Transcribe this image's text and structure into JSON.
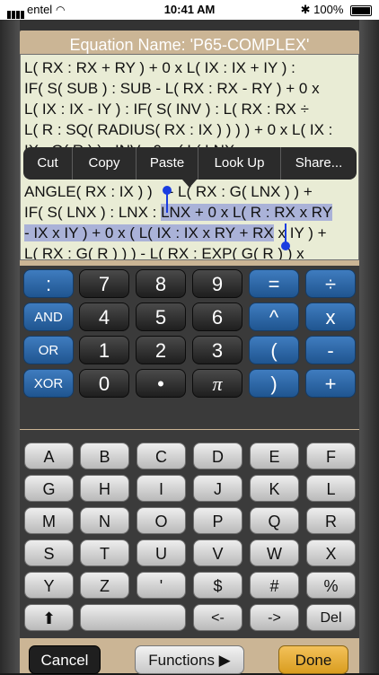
{
  "status": {
    "carrier": "entel",
    "time": "10:41 AM",
    "battery": "100%"
  },
  "title": "Equation Name: 'P65-COMPLEX'",
  "editor": {
    "line1": "L( RX : RX + RY ) + 0 x L( IX : IX + IY ) :",
    "line2": "IF( S( SUB ) : SUB - L( RX : RX - RY ) + 0 x",
    "line3": "L( IX : IX - IY ) : IF( S( INV ) : L( RX : RX ÷",
    "line4": "L( R : SQ( RADIUS( RX : IX ) ) ) ) + 0 x L( IX :",
    "line5": "IX : G( R ) ) : INV : 0 x ( L( LNX :",
    "line7a": "ANGLE( RX : IX ) )",
    "line7b": "- L( RX : G( LNX ) ) +",
    "line8a": "IF( S( LNX ) : LNX :",
    "line8b": "LNX + 0 x L( R : RX x RY",
    "line9a": "- IX x IY ) + 0 x ( L( IX : IX x RY + RX",
    "line9b": "x IY ) +",
    "line10": "L( RX : G( R ) ) ) - L( RX : EXP( G( R ) ) x"
  },
  "context_menu": [
    "Cut",
    "Copy",
    "Paste",
    "Look Up",
    "Share..."
  ],
  "keypad": {
    "row1": [
      ":",
      "7",
      "8",
      "9",
      "=",
      "÷"
    ],
    "row2": [
      "AND",
      "4",
      "5",
      "6",
      "^",
      "x"
    ],
    "row3": [
      "OR",
      "1",
      "2",
      "3",
      "(",
      "-"
    ],
    "row4": [
      "XOR",
      "0",
      "•",
      "π",
      ")",
      "+"
    ]
  },
  "letters": {
    "row1": [
      "A",
      "B",
      "C",
      "D",
      "E",
      "F"
    ],
    "row2": [
      "G",
      "H",
      "I",
      "J",
      "K",
      "L"
    ],
    "row3": [
      "M",
      "N",
      "O",
      "P",
      "Q",
      "R"
    ],
    "row4": [
      "S",
      "T",
      "U",
      "V",
      "W",
      "X"
    ],
    "row5": [
      "Y",
      "Z",
      "'",
      "$",
      "#",
      "%"
    ],
    "row6": [
      "⬆",
      "",
      "<-",
      "->",
      "Del"
    ]
  },
  "buttons": {
    "cancel": "Cancel",
    "functions": "Functions ▶",
    "done": "Done"
  },
  "colors": {
    "panel": "#cbb595",
    "editor_bg": "#e9ecd5",
    "selection": "#aab2d8",
    "operator_blue": "#2c68a8",
    "done_yellow": "#e7ae37"
  }
}
